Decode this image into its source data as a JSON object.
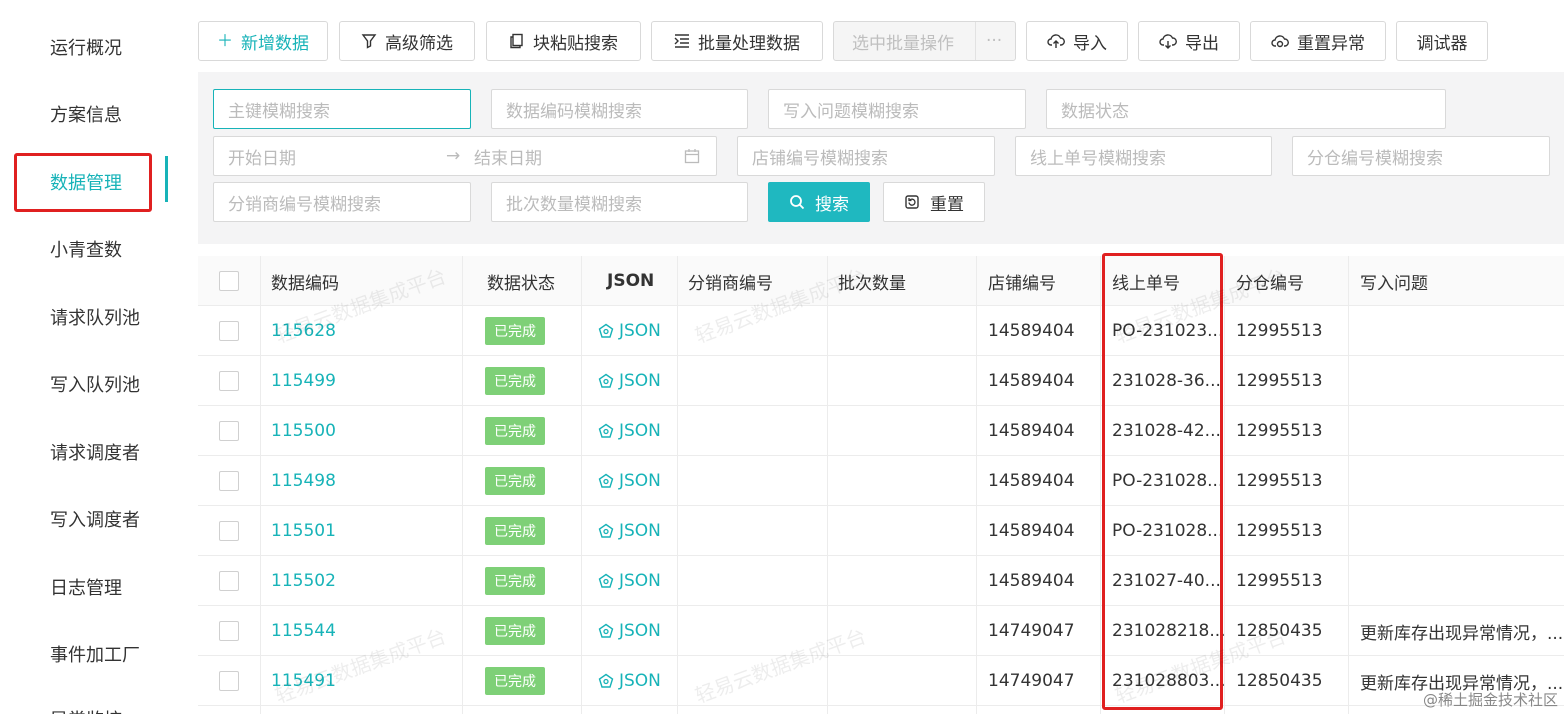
{
  "sidebar": {
    "items": [
      {
        "label": "运行概况"
      },
      {
        "label": "方案信息"
      },
      {
        "label": "数据管理",
        "active": true
      },
      {
        "label": "小青查数"
      },
      {
        "label": "请求队列池"
      },
      {
        "label": "写入队列池"
      },
      {
        "label": "请求调度者"
      },
      {
        "label": "写入调度者"
      },
      {
        "label": "日志管理"
      },
      {
        "label": "事件加工厂"
      },
      {
        "label": "异常监控"
      }
    ]
  },
  "toolbar": {
    "add_label": "新增数据",
    "filter_label": "高级筛选",
    "paste_search_label": "块粘贴搜索",
    "batch_process_label": "批量处理数据",
    "batch_selected_label": "选中批量操作",
    "more_label": "···",
    "import_label": "导入",
    "export_label": "导出",
    "reset_error_label": "重置异常",
    "debugger_label": "调试器"
  },
  "search": {
    "primary_key_placeholder": "主键模糊搜索",
    "data_code_placeholder": "数据编码模糊搜索",
    "write_issue_placeholder": "写入问题模糊搜索",
    "data_status_placeholder": "数据状态",
    "start_date_placeholder": "开始日期",
    "date_separator": "→",
    "end_date_placeholder": "结束日期",
    "store_code_placeholder": "店铺编号模糊搜索",
    "online_order_placeholder": "线上单号模糊搜索",
    "warehouse_code_placeholder": "分仓编号模糊搜索",
    "distributor_code_placeholder": "分销商编号模糊搜索",
    "batch_qty_placeholder": "批次数量模糊搜索",
    "search_label": "搜索",
    "reset_label": "重置"
  },
  "table": {
    "columns": [
      "数据编码",
      "数据状态",
      "JSON",
      "分销商编号",
      "批次数量",
      "店铺编号",
      "线上单号",
      "分仓编号",
      "写入问题"
    ],
    "rows": [
      {
        "code": "115628",
        "status": "已完成",
        "json": "JSON",
        "distributor": "",
        "batch": "",
        "store": "14589404",
        "order": "PO-231023...",
        "warehouse": "12995513",
        "issue": ""
      },
      {
        "code": "115499",
        "status": "已完成",
        "json": "JSON",
        "distributor": "",
        "batch": "",
        "store": "14589404",
        "order": "231028-36...",
        "warehouse": "12995513",
        "issue": ""
      },
      {
        "code": "115500",
        "status": "已完成",
        "json": "JSON",
        "distributor": "",
        "batch": "",
        "store": "14589404",
        "order": "231028-42...",
        "warehouse": "12995513",
        "issue": ""
      },
      {
        "code": "115498",
        "status": "已完成",
        "json": "JSON",
        "distributor": "",
        "batch": "",
        "store": "14589404",
        "order": "PO-231028...",
        "warehouse": "12995513",
        "issue": ""
      },
      {
        "code": "115501",
        "status": "已完成",
        "json": "JSON",
        "distributor": "",
        "batch": "",
        "store": "14589404",
        "order": "PO-231028...",
        "warehouse": "12995513",
        "issue": ""
      },
      {
        "code": "115502",
        "status": "已完成",
        "json": "JSON",
        "distributor": "",
        "batch": "",
        "store": "14589404",
        "order": "231027-40...",
        "warehouse": "12995513",
        "issue": ""
      },
      {
        "code": "115544",
        "status": "已完成",
        "json": "JSON",
        "distributor": "",
        "batch": "",
        "store": "14749047",
        "order": "231028218...",
        "warehouse": "12850435",
        "issue": "更新库存出现异常情况，..."
      },
      {
        "code": "115491",
        "status": "已完成",
        "json": "JSON",
        "distributor": "",
        "batch": "",
        "store": "14749047",
        "order": "231028803...",
        "warehouse": "12850435",
        "issue": "更新库存出现异常情况，..."
      }
    ]
  },
  "watermark_text": "轻易云数据集成平台",
  "footer_mark": "@稀土掘金技术社区",
  "colors": {
    "accent": "#17b3b8",
    "highlight": "#e02020",
    "badge": "#7ed077"
  }
}
